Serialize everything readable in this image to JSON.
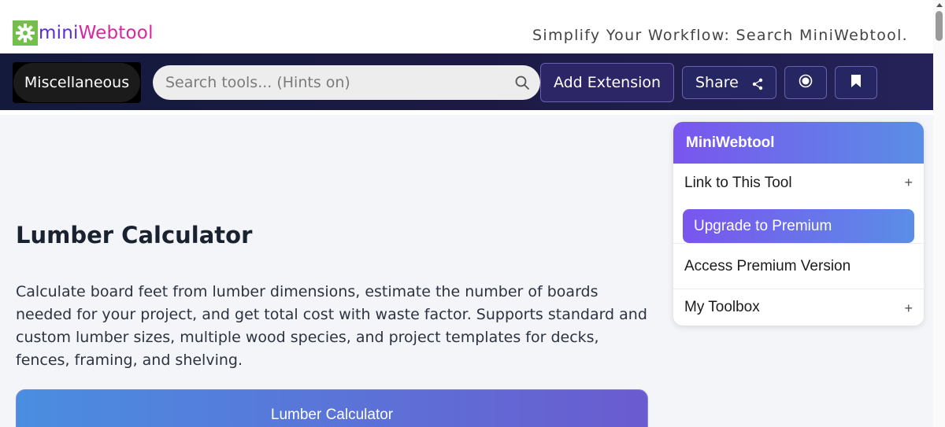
{
  "header": {
    "logo_mini": "mini",
    "logo_web": "Webtool",
    "tagline": "Simplify Your Workflow: Search MiniWebtool."
  },
  "navbar": {
    "category_label": "Miscellaneous",
    "search_placeholder": "Search tools... (Hints on)",
    "add_extension_label": "Add Extension",
    "share_label": "Share",
    "icons": [
      "search-icon",
      "share-icon",
      "record-icon",
      "bookmark-icon"
    ]
  },
  "main": {
    "title": "Lumber Calculator",
    "description": "Calculate board feet from lumber dimensions, estimate the number of boards needed for your project, and get total cost with waste factor. Supports standard and custom lumber sizes, multiple wood species, and project templates for decks, fences, framing, and shelving.",
    "calculator_title": "Lumber Calculator"
  },
  "sidebar": {
    "title": "MiniWebtool",
    "link_label": "Link to This Tool",
    "upgrade_label": "Upgrade to Premium",
    "premium_label": "Access Premium Version",
    "toolbox_label": "My Toolbox",
    "expand_symbol": "+"
  },
  "colors": {
    "navbar_bg": "#1c1a44",
    "accent_purple": "#7a55ee",
    "accent_blue": "#5a8ee6",
    "logo_green": "#72c04a",
    "logo_mini": "#5b2bd6",
    "logo_web": "#d6289c"
  }
}
